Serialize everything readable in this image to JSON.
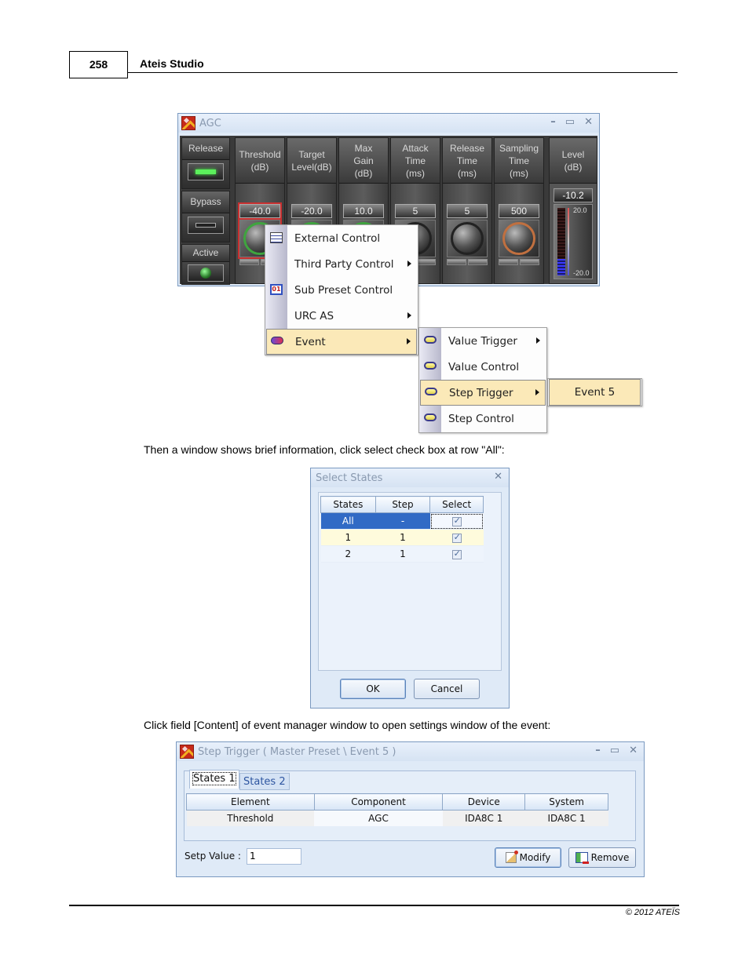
{
  "page": {
    "number": "258",
    "title": "Ateis Studio",
    "footer": "© 2012 ATEÏS",
    "paragraph1": "Then a window shows brief information, click select check box at row \"All\":",
    "paragraph2": "Click field [Content] of event manager window to open settings window of the event:"
  },
  "agc_window": {
    "title": "AGC",
    "window_controls": [
      "–",
      "▭",
      "✕"
    ],
    "side_controls": [
      {
        "label": "Release",
        "state": "on"
      },
      {
        "label": "Bypass",
        "state": "off"
      },
      {
        "label": "Active",
        "state": "on"
      }
    ],
    "channels": [
      {
        "header": "Threshold\n(dB)",
        "value": "-40.0",
        "knob": "green",
        "selected": true
      },
      {
        "header": "Target\nLevel(dB)",
        "value": "-20.0",
        "knob": "green",
        "selected": false
      },
      {
        "header": "Max\nGain\n(dB)",
        "value": "10.0",
        "knob": "green",
        "selected": false
      },
      {
        "header": "Attack\nTime\n(ms)",
        "value": "5",
        "knob": "dark",
        "selected": false
      },
      {
        "header": "Release\nTime\n(ms)",
        "value": "5",
        "knob": "dark",
        "selected": false
      },
      {
        "header": "Sampling\nTime\n(ms)",
        "value": "500",
        "knob": "copper",
        "selected": false
      }
    ],
    "level": {
      "header": "Level\n(dB)",
      "value": "-10.2",
      "scale_max": "20.0",
      "scale_min": "-20.0",
      "fill_fraction": 0.245
    }
  },
  "context_menu": {
    "items": [
      {
        "label": "External Control",
        "icon": "external-control-icon",
        "submenu": false
      },
      {
        "label": "Third Party Control",
        "icon": "",
        "submenu": true
      },
      {
        "label": "Sub Preset Control",
        "icon": "sub-preset-icon",
        "icon_text": "01",
        "submenu": false
      },
      {
        "label": "URC AS",
        "icon": "",
        "submenu": true
      },
      {
        "label": "Event",
        "icon": "event-icon",
        "submenu": true,
        "highlighted": true
      }
    ]
  },
  "event_submenu": {
    "items": [
      {
        "label": "Value Trigger",
        "submenu": true
      },
      {
        "label": "Value Control",
        "submenu": false
      },
      {
        "label": "Step Trigger",
        "submenu": true,
        "highlighted": true
      },
      {
        "label": "Step Control",
        "submenu": false
      }
    ]
  },
  "step_trigger_submenu": {
    "items": [
      {
        "label": "Event 5",
        "highlighted": true
      }
    ]
  },
  "select_states_dialog": {
    "title": "Select States",
    "close": "✕",
    "columns": [
      "States",
      "Step",
      "Select"
    ],
    "rows": [
      {
        "state": "All",
        "step": "-",
        "selected": true
      },
      {
        "state": "1",
        "step": "1",
        "selected": true
      },
      {
        "state": "2",
        "step": "1",
        "selected": true
      }
    ],
    "ok_label": "OK",
    "cancel_label": "Cancel"
  },
  "step_trigger_window": {
    "title": "Step Trigger ( Master Preset \\ Event 5 )",
    "window_controls": [
      "–",
      "▭",
      "✕"
    ],
    "tabs": [
      {
        "label": "States 1",
        "active": true
      },
      {
        "label": "States 2",
        "active": false
      }
    ],
    "columns": [
      "Element",
      "Component",
      "Device",
      "System"
    ],
    "rows": [
      {
        "element": "Threshold",
        "component": "AGC",
        "device": "IDA8C 1",
        "system": "IDA8C 1"
      }
    ],
    "setp_label": "Setp Value :",
    "setp_value": "1",
    "modify_label": "Modify",
    "remove_label": "Remove"
  }
}
